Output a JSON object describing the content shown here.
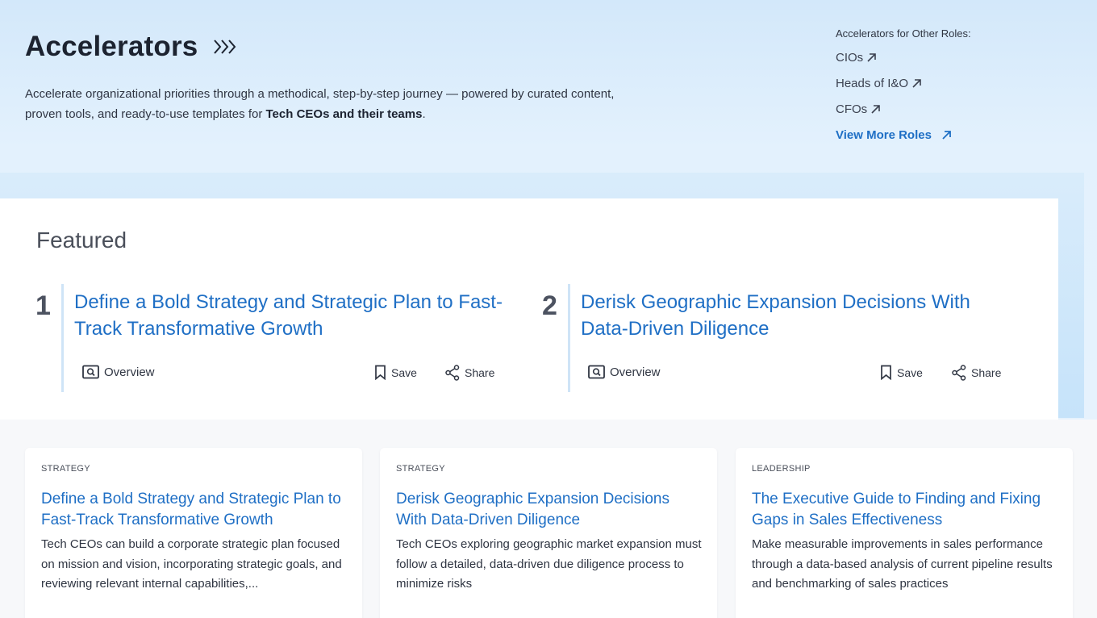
{
  "hero": {
    "title": "Accelerators",
    "desc_before": "Accelerate organizational priorities through a methodical, step-by-step journey — powered by curated content, proven tools, and ready-to-use templates for ",
    "desc_bold": "Tech CEOs and their teams",
    "desc_after": "."
  },
  "roles": {
    "label": "Accelerators for Other Roles:",
    "items": [
      {
        "label": "CIOs"
      },
      {
        "label": "Heads of I&O"
      },
      {
        "label": "CFOs"
      }
    ],
    "more_label": "View More Roles"
  },
  "featured": {
    "title": "Featured",
    "items": [
      {
        "number": "1",
        "title": "Define a Bold Strategy and Strategic Plan to Fast-Track Transformative Growth",
        "overview_label": "Overview",
        "save_label": "Save",
        "share_label": "Share"
      },
      {
        "number": "2",
        "title": "Derisk Geographic Expansion Decisions With Data-Driven Diligence",
        "overview_label": "Overview",
        "save_label": "Save",
        "share_label": "Share"
      }
    ]
  },
  "cards": [
    {
      "category": "STRATEGY",
      "title": "Define a Bold Strategy and Strategic Plan to Fast-Track Transformative Growth",
      "description": "Tech CEOs can build a corporate strategic plan focused on mission and vision, incorporating strategic goals, and reviewing relevant internal capabilities,..."
    },
    {
      "category": "STRATEGY",
      "title": "Derisk Geographic Expansion Decisions With Data-Driven Diligence",
      "description": "Tech CEOs exploring geographic market expansion must follow a detailed, data-driven due diligence process to minimize risks"
    },
    {
      "category": "LEADERSHIP",
      "title": "The Executive Guide to Finding and Fixing Gaps in Sales Effectiveness",
      "description": "Make measurable improvements in sales performance through a data-based analysis of current pipeline results and benchmarking of sales practices"
    }
  ],
  "icons": {
    "title_chevrons": "triple-chevron-right-icon",
    "role_arrow": "arrow-up-right-icon",
    "overview": "search-document-icon",
    "save": "bookmark-icon",
    "share": "share-icon"
  },
  "colors": {
    "accent_link": "#1f6fc5",
    "hero_bg": "#e3f1fd",
    "text": "#1f2430"
  }
}
